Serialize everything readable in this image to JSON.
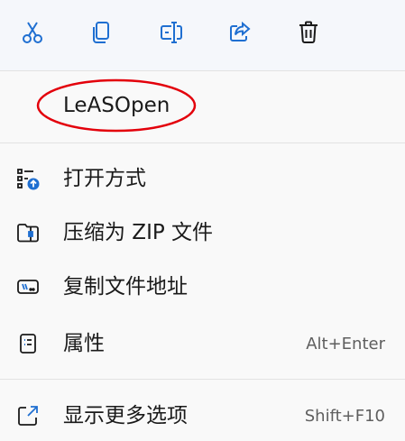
{
  "toolbar": {
    "buttons": [
      {
        "name": "cut",
        "icon": "scissors-icon"
      },
      {
        "name": "copy",
        "icon": "copy-icon"
      },
      {
        "name": "rename",
        "icon": "rename-icon"
      },
      {
        "name": "share",
        "icon": "share-icon"
      },
      {
        "name": "delete",
        "icon": "trash-icon"
      }
    ],
    "icon_color": "#1f6fd1"
  },
  "app_entry": {
    "label": "LeASOpen",
    "annotation_color": "#e3000b"
  },
  "menu": {
    "items": [
      {
        "label": "打开方式",
        "shortcut": "",
        "icon": "open-with-icon"
      },
      {
        "label": "压缩为 ZIP 文件",
        "shortcut": "",
        "icon": "zip-folder-icon"
      },
      {
        "label": "复制文件地址",
        "shortcut": "",
        "icon": "copy-path-icon"
      },
      {
        "label": "属性",
        "shortcut": "Alt+Enter",
        "icon": "properties-icon"
      },
      {
        "label": "显示更多选项",
        "shortcut": "Shift+F10",
        "icon": "more-options-icon"
      }
    ]
  }
}
